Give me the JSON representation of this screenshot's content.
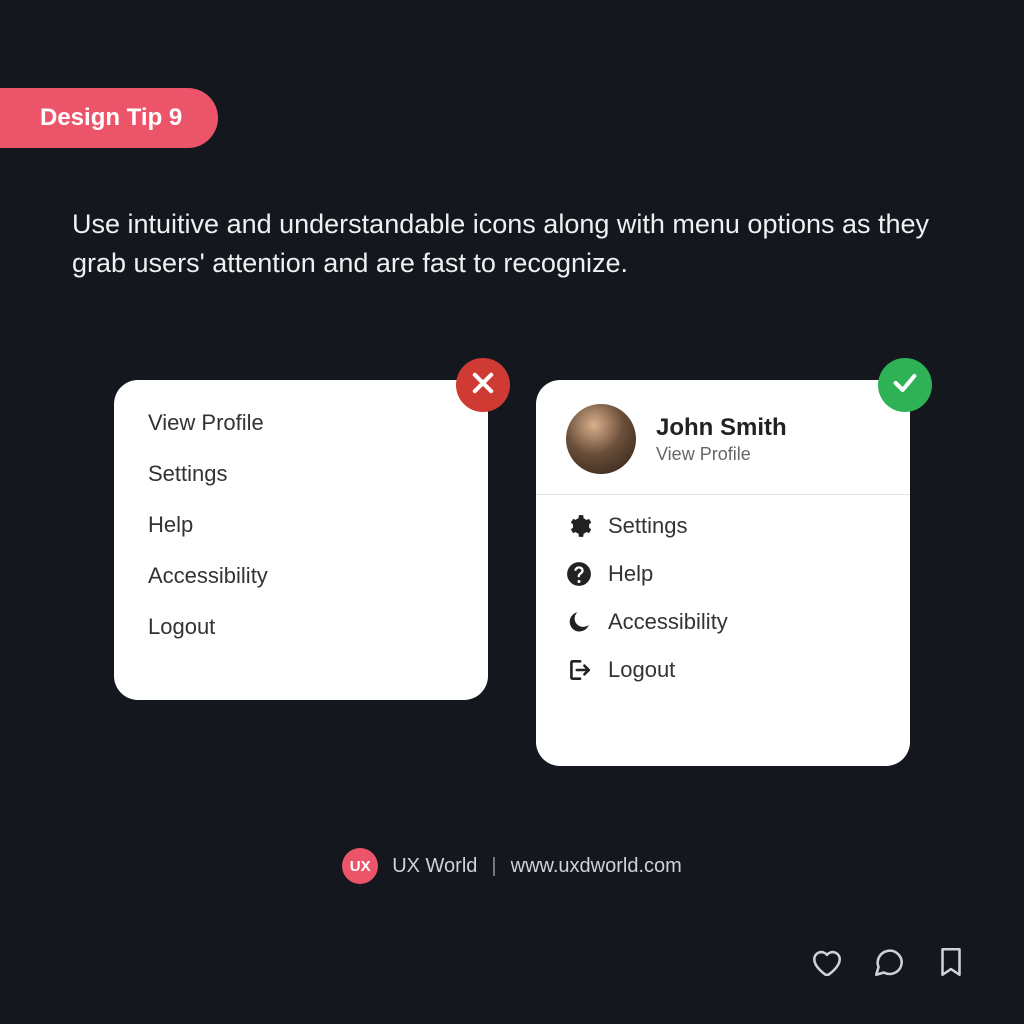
{
  "badge": {
    "label": "Design Tip 9"
  },
  "tip": "Use intuitive and understandable icons along with menu options as they grab users' attention and are fast to recognize.",
  "bad_card": {
    "items": [
      "View Profile",
      "Settings",
      "Help",
      "Accessibility",
      "Logout"
    ]
  },
  "good_card": {
    "name": "John Smith",
    "subtitle": "View Profile",
    "items": [
      {
        "icon": "gear-icon",
        "label": "Settings"
      },
      {
        "icon": "question-icon",
        "label": "Help"
      },
      {
        "icon": "moon-icon",
        "label": "Accessibility"
      },
      {
        "icon": "logout-icon",
        "label": "Logout"
      }
    ]
  },
  "footer": {
    "logo": "UX",
    "brand": "UX World",
    "sep": "|",
    "url": "www.uxdworld.com"
  }
}
